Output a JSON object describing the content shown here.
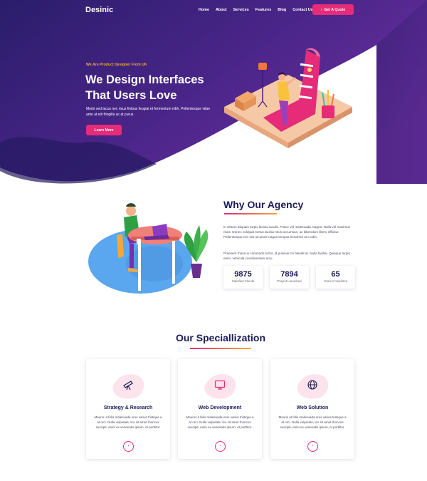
{
  "brand": {
    "logo": "Desinic",
    "accent": "#e62b78",
    "secondary": "#f2a83b",
    "hero_bg": "#3a1e7a"
  },
  "nav": {
    "items": [
      "Home",
      "About",
      "Services",
      "Features",
      "Blog",
      "Contact Us"
    ],
    "quote_label": "Get A Quote",
    "quote_icon": "arrow-right-icon"
  },
  "hero": {
    "kicker": "We Are Product Designer From UK",
    "title_line1": "We Design Interfaces",
    "title_line2": "That Users Love",
    "description": "Morbi sed lacus nec risus finibus feugiat et fermentum nibh. Pellentesque vitae ante at elit fringilla ac at purus.",
    "button_label": "Learn More"
  },
  "why": {
    "title": "Why Our Agency",
    "paragraph1": "In dictum aliquam turpis lacinia iaculis. Fusce vel malesuada magna. Nulla vel maximus risus. Donec volutpat metus lacinia risus accumsan, ac bibendum libero efficitur. Pellentesque nec nisi sit amet magna tempus hendrerit ut a odio.",
    "paragraph2": "Praesent rhoncus commodo tortor, id pulvinar mi blandit at. Nulla facilisi. Quisque turpis enim, vehicula condimentum arcu.",
    "stats": [
      {
        "value": "9875",
        "label": "Satisfied Clients"
      },
      {
        "value": "7894",
        "label": "Project Lanuched"
      },
      {
        "value": "65",
        "label": "Years Completed"
      }
    ]
  },
  "specialization": {
    "title": "Our Speciallization",
    "cards": [
      {
        "icon": "telescope-icon",
        "title": "Strategy & Research",
        "description": "Mauris ut felis malesuada eros varius tristique a at orci. Nulla vulputate, leo sit amet rhoncus suscipit, enim ex venenatis ipsum, et porttitor."
      },
      {
        "icon": "monitor-icon",
        "title": "Web Development",
        "description": "Mauris ut felis malesuada eros varius tristique a at orci. Nulla vulputate, leo sit amet rhoncus suscipit, enim ex venenatis ipsum, et porttitor."
      },
      {
        "icon": "globe-icon",
        "title": "Web Solution",
        "description": "Mauris ut felis malesuada eros varius tristique a at orci. Nulla vulputate, leo sit amet rhoncus suscipit, enim ex venenatis ipsum, et porttitor."
      }
    ],
    "card_button_icon": "chevron-right-icon"
  }
}
